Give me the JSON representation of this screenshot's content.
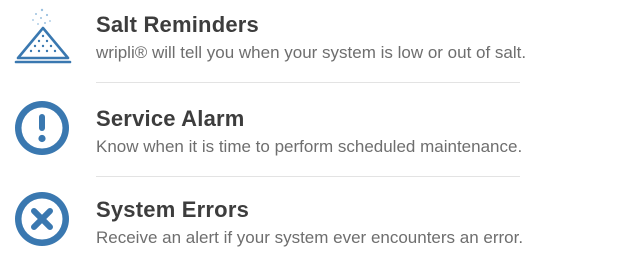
{
  "features": [
    {
      "icon": "salt-pile-icon",
      "title": "Salt Reminders",
      "description": "wripli® will tell you when your system is low or out of salt."
    },
    {
      "icon": "exclamation-circle-icon",
      "title": "Service Alarm",
      "description": "Know when it is time to perform scheduled maintenance."
    },
    {
      "icon": "x-circle-icon",
      "title": "System Errors",
      "description": "Receive an alert if your system ever encounters an error."
    }
  ],
  "colors": {
    "icon_blue": "#3a78b0",
    "icon_blue_light": "#9cc1e0",
    "title": "#3d3d3d",
    "description": "#6e6e6e",
    "divider": "#e3e3e3"
  }
}
